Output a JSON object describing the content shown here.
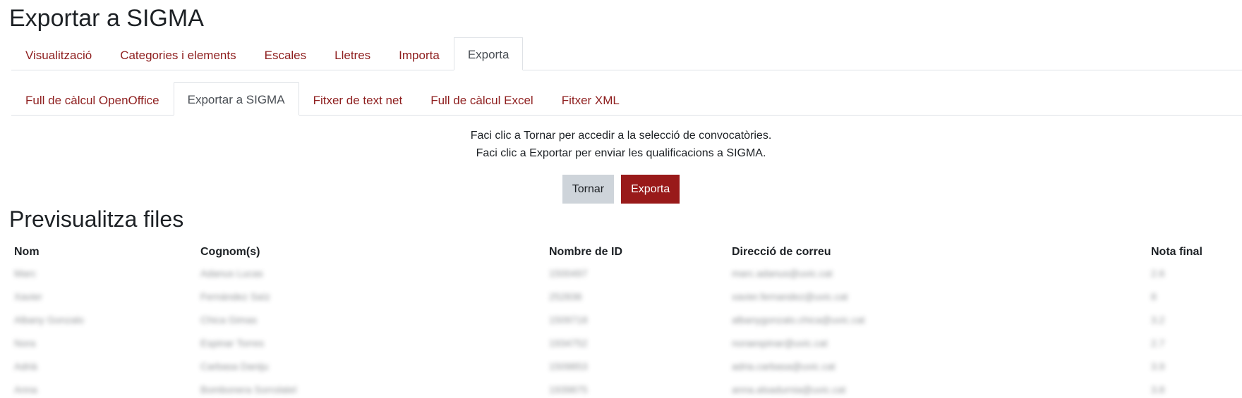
{
  "page_title": "Exportar a SIGMA",
  "primary_tabs": [
    {
      "label": "Visualització",
      "active": false
    },
    {
      "label": "Categories i elements",
      "active": false
    },
    {
      "label": "Escales",
      "active": false
    },
    {
      "label": "Lletres",
      "active": false
    },
    {
      "label": "Importa",
      "active": false
    },
    {
      "label": "Exporta",
      "active": true
    }
  ],
  "secondary_tabs": [
    {
      "label": "Full de càlcul OpenOffice",
      "active": false
    },
    {
      "label": "Exportar a SIGMA",
      "active": true
    },
    {
      "label": "Fitxer de text net",
      "active": false
    },
    {
      "label": "Full de càlcul Excel",
      "active": false
    },
    {
      "label": "Fitxer XML",
      "active": false
    }
  ],
  "instructions": {
    "line1": "Faci clic a Tornar per accedir a la selecció de convocatòries.",
    "line2": "Faci clic a Exportar per enviar les qualificacions a SIGMA."
  },
  "buttons": {
    "back_label": "Tornar",
    "export_label": "Exporta"
  },
  "preview": {
    "title": "Previsualitza files",
    "columns": [
      "Nom",
      "Cognom(s)",
      "Nombre de ID",
      "Direcció de correu",
      "Nota final"
    ],
    "rows": [
      [
        "Marc",
        "Adanus Lucas",
        "1500497",
        "marc.adanus@uvic.cat",
        "2.6"
      ],
      [
        "Xavier",
        "Fernández Saïz",
        "252836",
        "xavier.fernandez@uvic.cat",
        "8"
      ],
      [
        "Albany Gonzalo",
        "Chica Gimas",
        "1509718",
        "albanygonzalo.chica@uvic.cat",
        "3.2"
      ],
      [
        "Nora",
        "Espinar Torres",
        "1934752",
        "noraespinar@uvic.cat",
        "2.7"
      ],
      [
        "Adrià",
        "Carbasa Daniju",
        "1509853",
        "adria.carbasa@uvic.cat",
        "3.9"
      ],
      [
        "Anna",
        "Bombonera Sorrolatel",
        "1939875",
        "anna.alsadurnia@uvic.cat",
        "3.8"
      ]
    ]
  },
  "colors": {
    "accent": "#991a1a",
    "link": "#8e1e1e",
    "secondary_button": "#ced4da"
  }
}
